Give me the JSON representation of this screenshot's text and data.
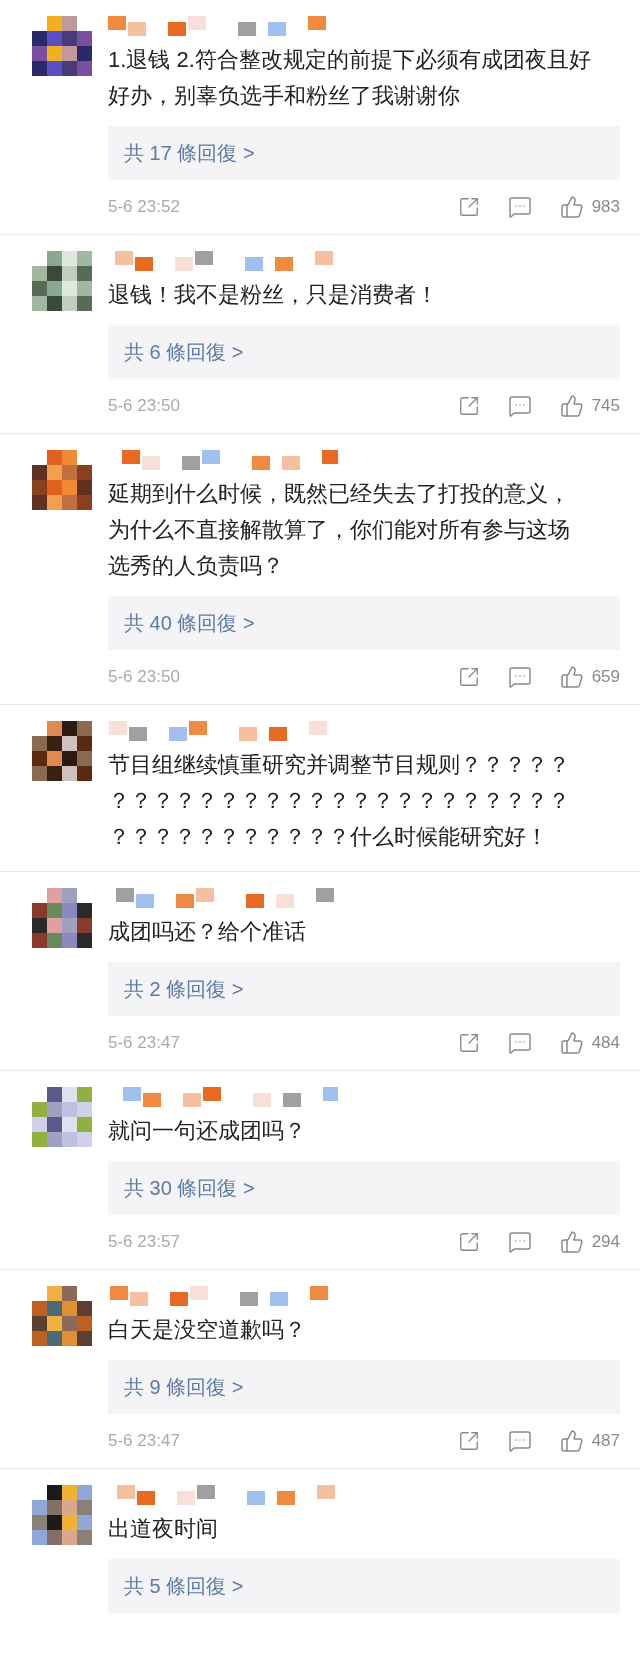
{
  "comments": [
    {
      "text": "1.退钱 2.符合整改规定的前提下必须有成团夜且好好办，别辜负选手和粉丝了我谢谢你",
      "replies": "共 17 條回復 >",
      "time": "5-6 23:52",
      "likes": "983"
    },
    {
      "text": "退钱！我不是粉丝，只是消费者！",
      "replies": "共 6 條回復 >",
      "time": "5-6 23:50",
      "likes": "745"
    },
    {
      "text": "延期到什么时候，既然已经失去了打投的意义，为什么不直接解散算了，你们能对所有参与这场选秀的人负责吗？",
      "replies": "共 40 條回復 >",
      "time": "5-6 23:50",
      "likes": "659"
    },
    {
      "text": "节目组继续慎重研究并调整节目规则？？？？？？？？？？？？？？？？？？？？？？？？？？？？？？？？？？？？？什么时候能研究好！"
    },
    {
      "text": "成团吗还？给个准话",
      "replies": "共 2 條回復 >",
      "time": "5-6 23:47",
      "likes": "484"
    },
    {
      "text": "就问一句还成团吗？",
      "replies": "共 30 條回復 >",
      "time": "5-6 23:57",
      "likes": "294"
    },
    {
      "text": "白天是没空道歉吗？",
      "replies": "共 9 條回復 >",
      "time": "5-6 23:47",
      "likes": "487"
    },
    {
      "text": "出道夜时间",
      "replies": "共 5 條回復 >"
    }
  ]
}
